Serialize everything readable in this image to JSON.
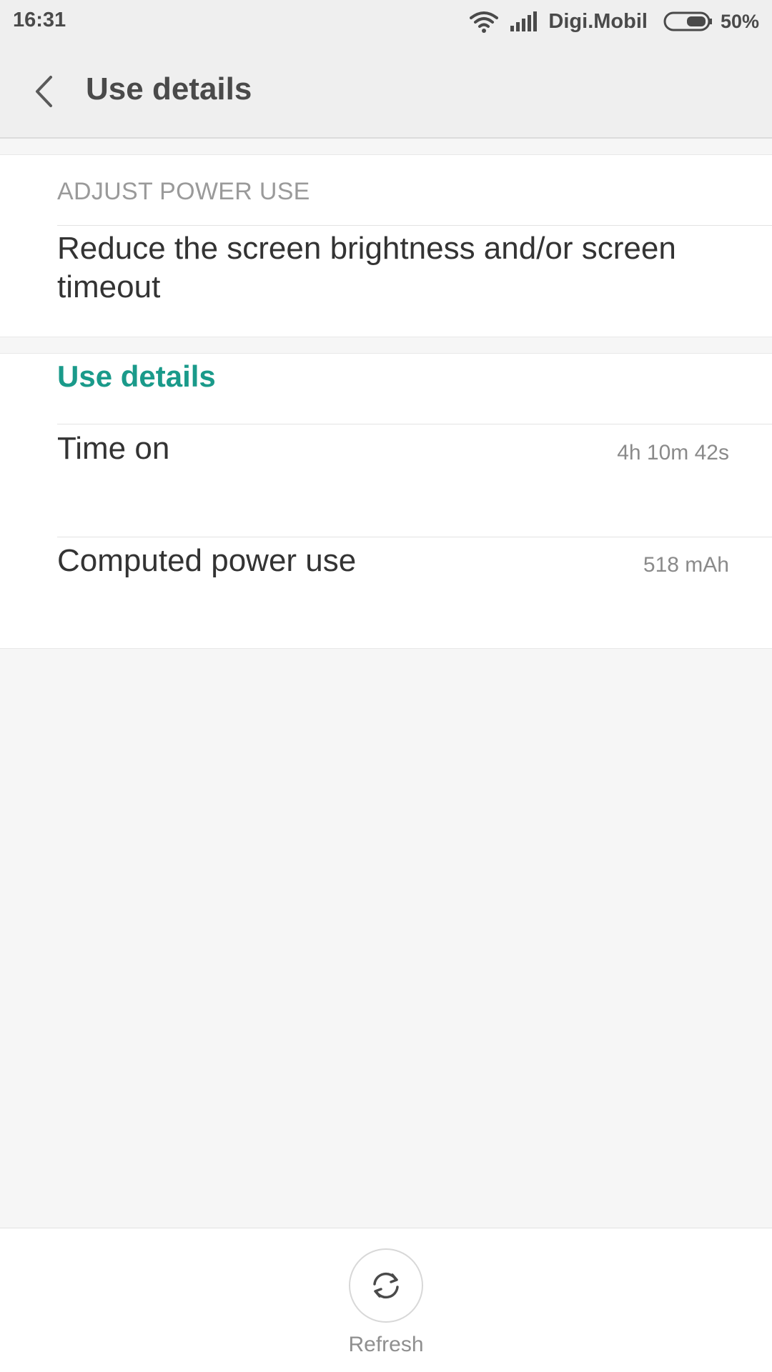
{
  "status_bar": {
    "time": "16:31",
    "carrier": "Digi.Mobil",
    "battery_percent": "50%",
    "battery_level": 0.5,
    "icons": [
      "wifi-icon",
      "signal-icon",
      "battery-icon"
    ]
  },
  "header": {
    "title": "Use details",
    "back_icon": "chevron-left-icon"
  },
  "adjust_section": {
    "label": "ADJUST POWER USE",
    "tip": "Reduce the screen brightness and/or screen timeout"
  },
  "details_section": {
    "title": "Use details",
    "rows": [
      {
        "label": "Time on",
        "value": "4h 10m 42s"
      },
      {
        "label": "Computed power use",
        "value": "518 mAh"
      }
    ]
  },
  "bottom_bar": {
    "refresh_label": "Refresh",
    "refresh_icon": "refresh-icon"
  },
  "colors": {
    "accent": "#1a9a8a",
    "background": "#f6f6f6",
    "header": "#efefef"
  }
}
